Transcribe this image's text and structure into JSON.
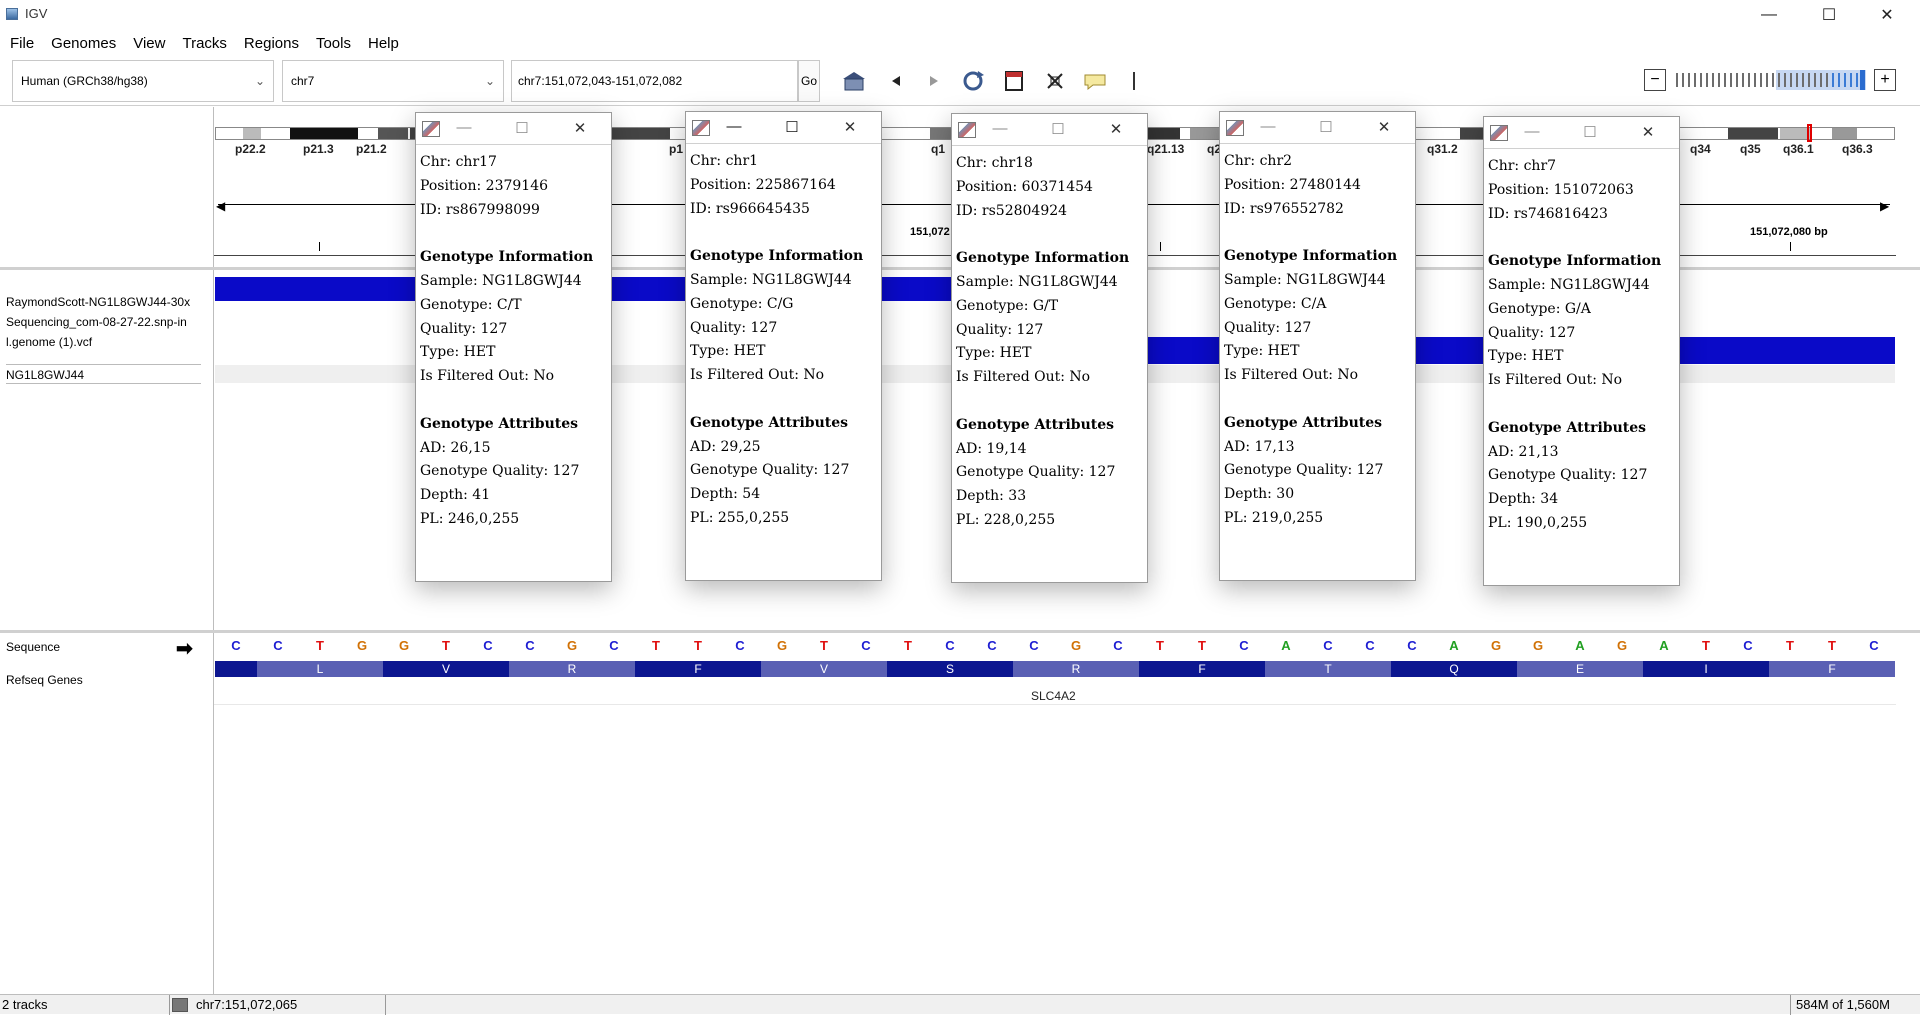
{
  "window": {
    "title": "IGV",
    "minimize": "—",
    "maximize": "☐",
    "close": "✕"
  },
  "menu": [
    "File",
    "Genomes",
    "View",
    "Tracks",
    "Regions",
    "Tools",
    "Help"
  ],
  "toolbar": {
    "genome": "Human (GRCh38/hg38)",
    "chromosome": "chr7",
    "locus": "chr7:151,072,043-151,072,082",
    "go_label": "Go",
    "zoom_out": "−",
    "zoom_in": "+",
    "icons": [
      "home-icon",
      "back-arrow-icon",
      "forward-arrow-icon",
      "refresh-icon",
      "region-of-interest-icon",
      "resize-icon",
      "popup-text-icon"
    ]
  },
  "ideogram": {
    "bands": [
      "p22.2",
      "p21.3",
      "p21.2",
      "p1",
      "q1",
      "q21.13",
      "q2",
      "q31.2",
      "q34",
      "q35",
      "q36.1",
      "q36.3"
    ],
    "ruler_labels": [
      "151,072",
      "151,072,080 bp"
    ]
  },
  "tracks": {
    "vcf_name_line1": "RaymondScott-NG1L8GWJ44-30x",
    "vcf_name_line2": "Sequencing_com-08-27-22.snp-in",
    "vcf_name_line3": "l.genome (1).vcf",
    "sample": "NG1L8GWJ44",
    "sequence": "Sequence",
    "refseq": "Refseq Genes",
    "gene": "SLC4A2"
  },
  "sequence_bases": [
    "C",
    "C",
    "T",
    "G",
    "G",
    "T",
    "C",
    "C",
    "G",
    "C",
    "T",
    "T",
    "C",
    "G",
    "T",
    "C",
    "T",
    "C",
    "C",
    "C",
    "G",
    "C",
    "T",
    "T",
    "C",
    "A",
    "C",
    "C",
    "C",
    "A",
    "G",
    "G",
    "A",
    "G",
    "A",
    "T",
    "C",
    "T",
    "T",
    "C"
  ],
  "amino_acids": [
    "",
    "L",
    "V",
    "R",
    "F",
    "V",
    "S",
    "R",
    "F",
    "T",
    "Q",
    "E",
    "I",
    "F"
  ],
  "base_colors": {
    "A": "#22a022",
    "C": "#1e1ed2",
    "G": "#d17105",
    "T": "#e01010"
  },
  "popups": [
    {
      "chr": "Chr: chr17",
      "position": "Position: 2379146",
      "id": "ID: rs867998099",
      "geno_header": "Genotype Information",
      "sample": "Sample: NG1L8GWJ44",
      "genotype": "Genotype: C/T",
      "quality": "Quality: 127",
      "type": "Type: HET",
      "filtered": "Is Filtered Out: No",
      "attr_header": "Genotype Attributes",
      "ad": "AD: 26,15",
      "gq": "Genotype Quality: 127",
      "depth": "Depth: 41",
      "pl": "PL: 246,0,255"
    },
    {
      "chr": "Chr: chr1",
      "position": "Position: 225867164",
      "id": "ID: rs966645435",
      "geno_header": "Genotype Information",
      "sample": "Sample: NG1L8GWJ44",
      "genotype": "Genotype: C/G",
      "quality": "Quality: 127",
      "type": "Type: HET",
      "filtered": "Is Filtered Out: No",
      "attr_header": "Genotype Attributes",
      "ad": "AD: 29,25",
      "gq": "Genotype Quality: 127",
      "depth": "Depth: 54",
      "pl": "PL: 255,0,255"
    },
    {
      "chr": "Chr: chr18",
      "position": "Position: 60371454",
      "id": "ID: rs52804924",
      "geno_header": "Genotype Information",
      "sample": "Sample: NG1L8GWJ44",
      "genotype": "Genotype: G/T",
      "quality": "Quality: 127",
      "type": "Type: HET",
      "filtered": "Is Filtered Out: No",
      "attr_header": "Genotype Attributes",
      "ad": "AD: 19,14",
      "gq": "Genotype Quality: 127",
      "depth": "Depth: 33",
      "pl": "PL: 228,0,255"
    },
    {
      "chr": "Chr: chr2",
      "position": "Position: 27480144",
      "id": "ID: rs976552782",
      "geno_header": "Genotype Information",
      "sample": "Sample: NG1L8GWJ44",
      "genotype": "Genotype: C/A",
      "quality": "Quality: 127",
      "type": "Type: HET",
      "filtered": "Is Filtered Out: No",
      "attr_header": "Genotype Attributes",
      "ad": "AD: 17,13",
      "gq": "Genotype Quality: 127",
      "depth": "Depth: 30",
      "pl": "PL: 219,0,255"
    },
    {
      "chr": "Chr: chr7",
      "position": "Position: 151072063",
      "id": "ID: rs746816423",
      "geno_header": "Genotype Information",
      "sample": "Sample: NG1L8GWJ44",
      "genotype": "Genotype: G/A",
      "quality": "Quality: 127",
      "type": "Type: HET",
      "filtered": "Is Filtered Out: No",
      "attr_header": "Genotype Attributes",
      "ad": "AD: 21,13",
      "gq": "Genotype Quality: 127",
      "depth": "Depth: 34",
      "pl": "PL: 190,0,255"
    }
  ],
  "status": {
    "tracks": "2 tracks",
    "position": "chr7:151,072,065",
    "memory": "584M of 1,560M"
  }
}
